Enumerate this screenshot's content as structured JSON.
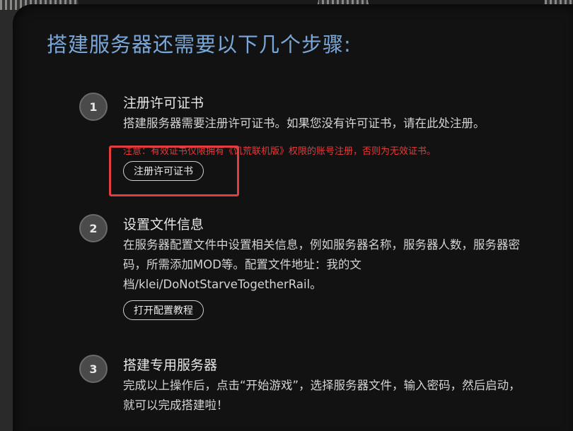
{
  "header": {
    "title": "搭建服务器还需要以下几个步骤:"
  },
  "steps": [
    {
      "number": "1",
      "title": "注册许可证书",
      "description": "搭建服务器需要注册许可证书。如果您没有许可证书，请在此处注册。",
      "warning": "注意：有效证书仅限拥有《饥荒联机版》权限的账号注册，否则为无效证书。",
      "button_label": "注册许可证书"
    },
    {
      "number": "2",
      "title": "设置文件信息",
      "description": "在服务器配置文件中设置相关信息，例如服务器名称，服务器人数，服务器密码，所需添加MOD等。配置文件地址：我的文档/klei/DoNotStarveTogetherRail。",
      "button_label": "打开配置教程"
    },
    {
      "number": "3",
      "title": "搭建专用服务器",
      "description": "完成以上操作后，点击“开始游戏”，选择服务器文件，输入密码，然后启动，就可以完成搭建啦！"
    }
  ],
  "colors": {
    "title": "#7aa7d9",
    "warning": "#e53a3a",
    "highlight": "#e33d3d",
    "panel_bg": "#121213"
  }
}
